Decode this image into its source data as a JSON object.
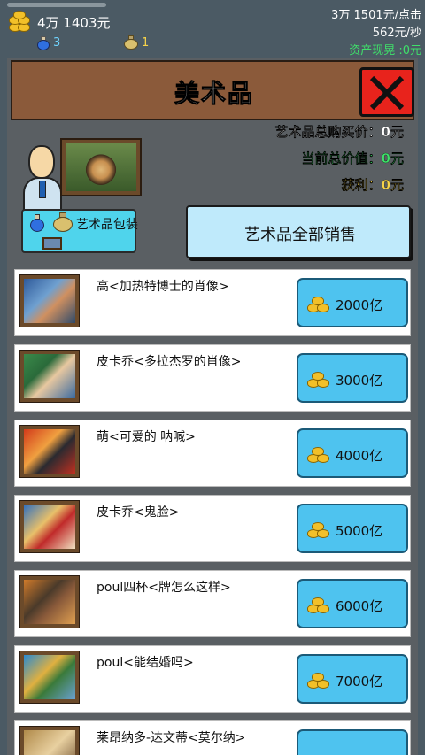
{
  "status": {
    "money": "4万 1403元",
    "potion_count": "3",
    "bag_count": "1",
    "per_click": "3万 1501元/点击",
    "per_second": "562元/秒",
    "cash_now": "资产现晃 :0元"
  },
  "header": {
    "title": "美术品"
  },
  "stats": {
    "total_cost": "艺术品总购买价：0元",
    "total_value": "当前总价值：0元",
    "profit": "获利：0元"
  },
  "art_bag_label": "艺术品包装",
  "sell_all_label": "艺术品全部销售",
  "items": [
    {
      "name": "高<加热特博士的肖像>",
      "price": "2000亿"
    },
    {
      "name": "皮卡乔<多拉杰罗的肖像>",
      "price": "3000亿"
    },
    {
      "name": "萌<可爱的 呐喊>",
      "price": "4000亿"
    },
    {
      "name": "皮卡乔<鬼脸>",
      "price": "5000亿"
    },
    {
      "name": "poul四杯<牌怎么这样>",
      "price": "6000亿"
    },
    {
      "name": "poul<能结婚吗>",
      "price": "7000亿"
    },
    {
      "name": "莱昂纳多-达文蒂<莫尔纳>",
      "price": ""
    }
  ],
  "colors": {
    "accent_blue": "#4ec3ef",
    "green": "#3fe06a",
    "yellow": "#f6d34a",
    "close_red": "#e8231c"
  }
}
